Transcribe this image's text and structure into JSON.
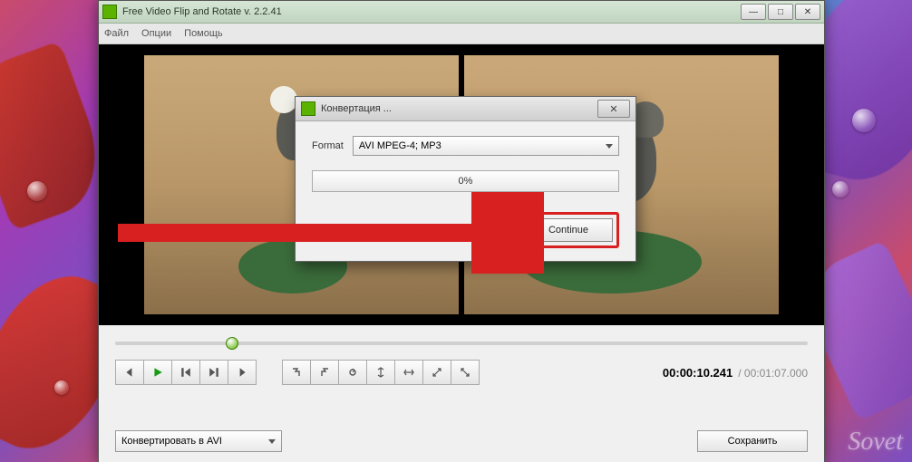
{
  "app": {
    "title": "Free Video Flip and Rotate v. 2.2.41",
    "menu": {
      "file": "Файл",
      "options": "Опции",
      "help": "Помощь"
    }
  },
  "playback": {
    "current": "00:00:10.241",
    "total": "00:01:07.000"
  },
  "bottom": {
    "convert_label": "Конвертировать в AVI",
    "save_label": "Сохранить"
  },
  "dialog": {
    "title": "Конвертация ...",
    "format_label": "Format",
    "format_value": "AVI MPEG-4; MP3",
    "progress": "0%",
    "continue": "Continue"
  },
  "window_controls": {
    "min": "—",
    "max": "□",
    "close": "✕"
  },
  "watermark": "Sovet"
}
